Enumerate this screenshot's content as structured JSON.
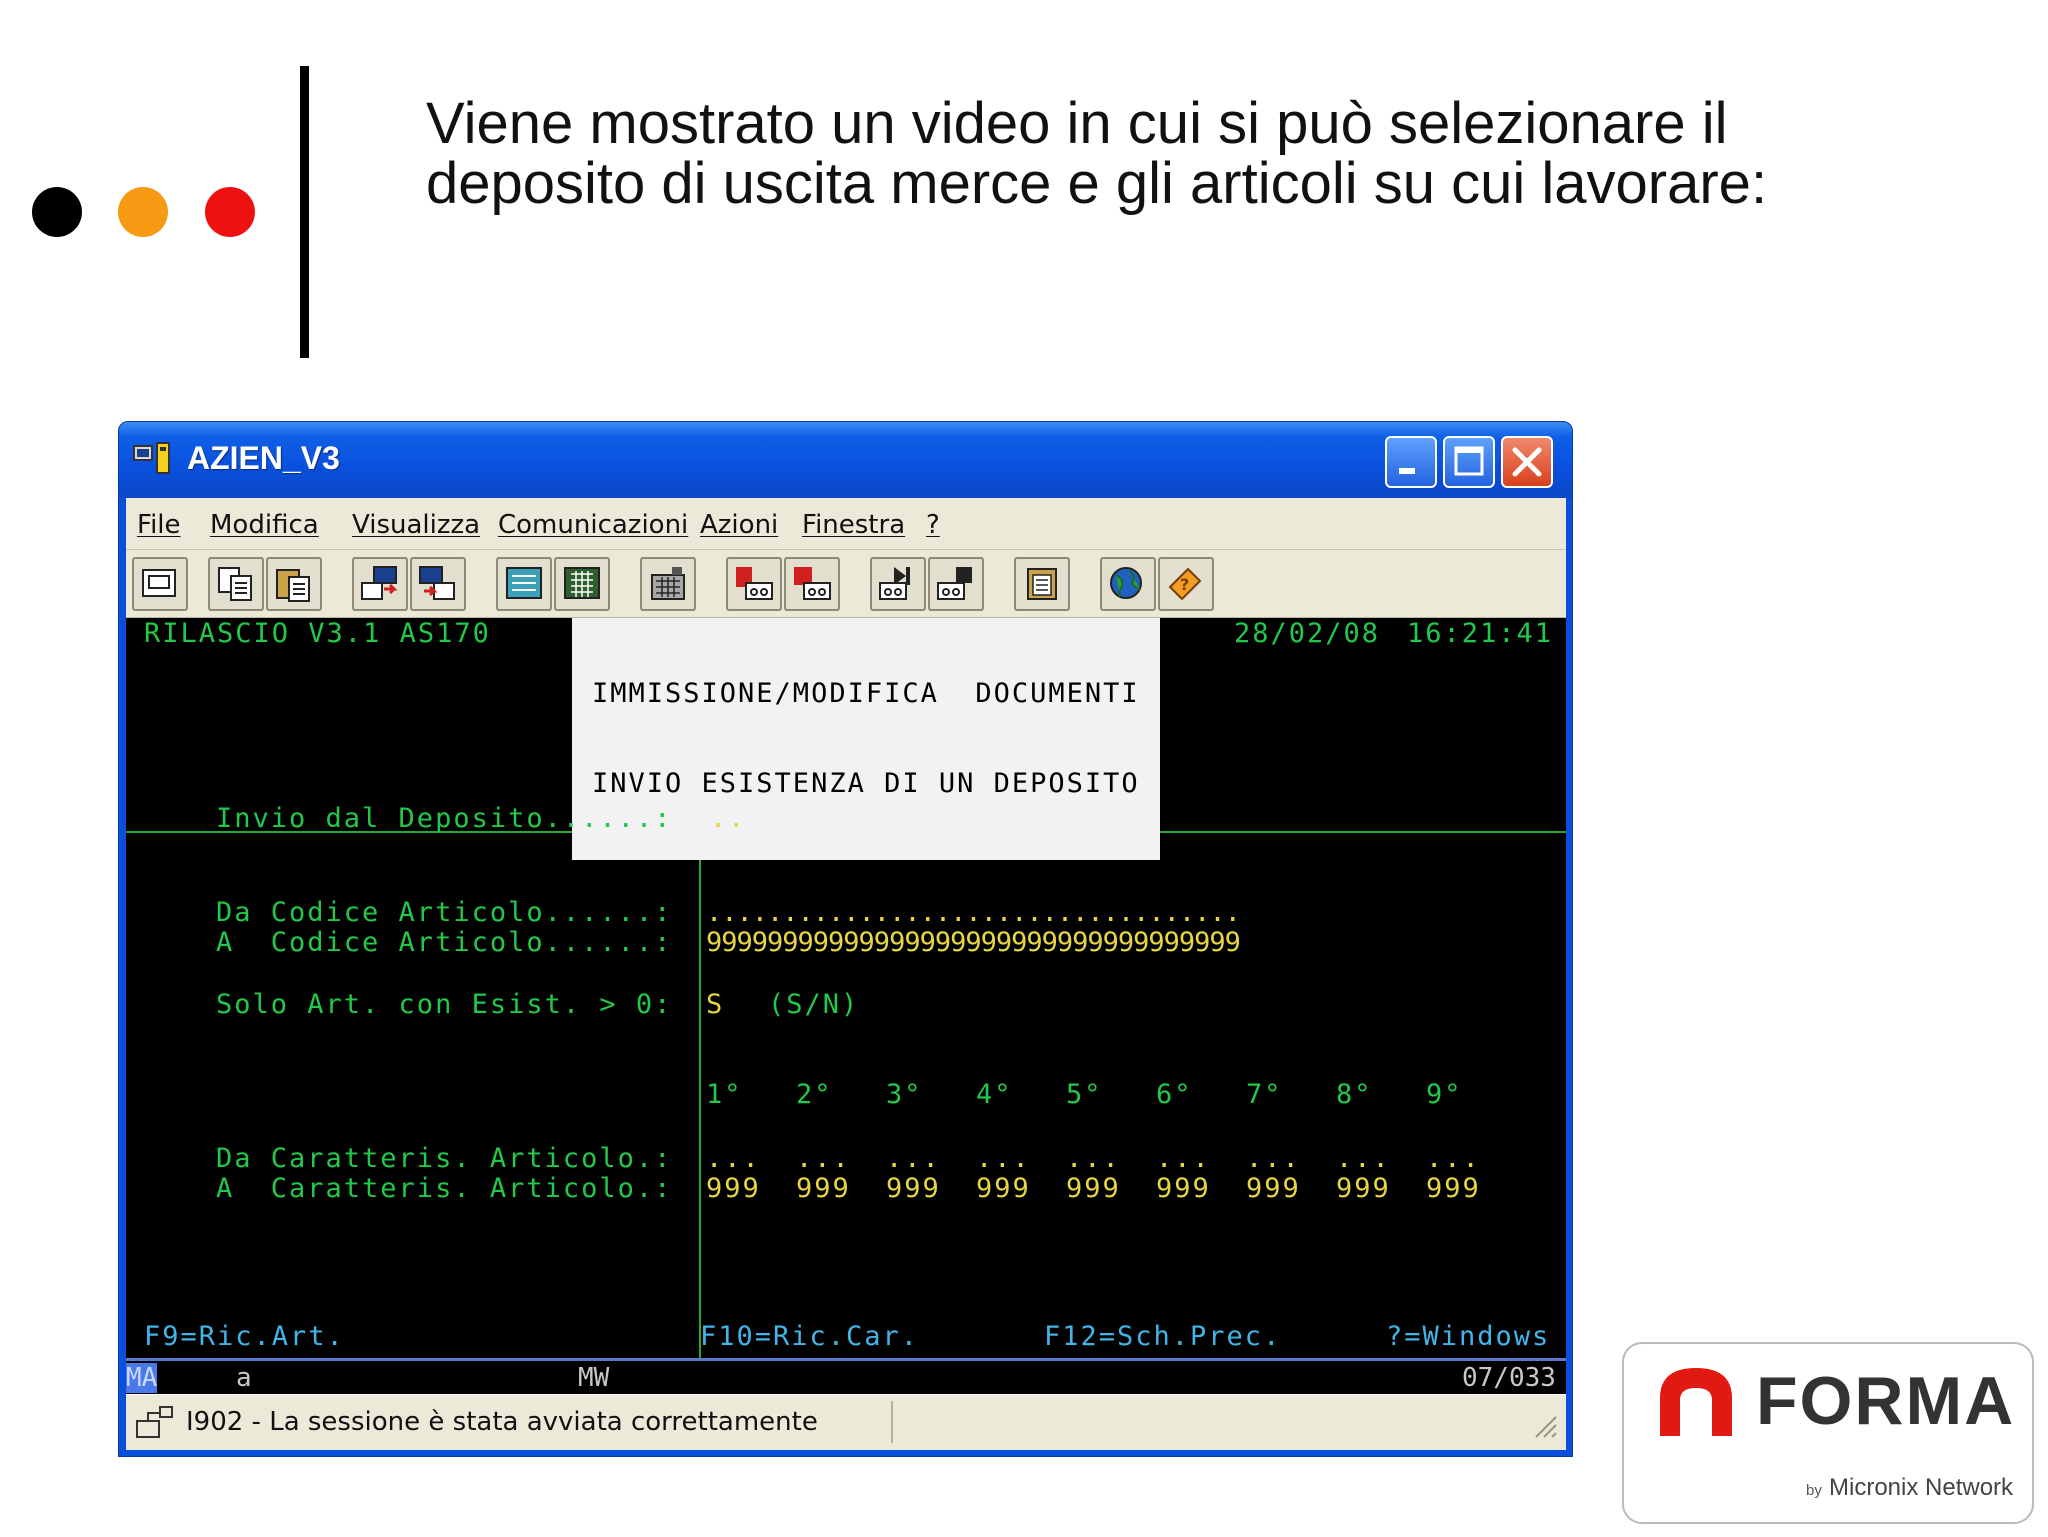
{
  "slide": {
    "title_line1": "Viene mostrato un video in cui si può selezionare il",
    "title_line2": "deposito di uscita merce e gli articoli su cui lavorare:"
  },
  "window": {
    "title": "AZIEN_V3",
    "controls": [
      "minimize-icon",
      "maximize-icon",
      "close-icon"
    ]
  },
  "menu": [
    "File",
    "Modifica",
    "Visualizza",
    "Comunicazioni",
    "Azioni",
    "Finestra",
    "?"
  ],
  "toolbar_icons": [
    "print-screen-icon",
    "copy-icon",
    "paste-icon",
    "send-icon",
    "receive-icon",
    "display-icon",
    "keypad-icon",
    "calculator-icon",
    "record-macro-icon",
    "stop-macro-icon",
    "play-macro-icon",
    "macro-icon",
    "clipboard-icon",
    "globe-icon",
    "help-icon"
  ],
  "terminal": {
    "release": "RILASCIO V3.1 AS170",
    "header_line1": "IMMISSIONE/MODIFICA  DOCUMENTI",
    "header_line2": "INVIO ESISTENZA DI UN DEPOSITO",
    "date": "28/02/08",
    "time": "16:21:41",
    "deposit_label": "Invio dal Deposito......:",
    "deposit_value": "..",
    "from_item_label": "Da Codice Articolo......:",
    "to_item_label": "A  Codice Articolo......:",
    "from_item_value": "...................................",
    "to_item_value": "99999999999999999999999999999999999",
    "stock_label": "Solo Art. con Esist. > 0:",
    "stock_value": "S",
    "stock_hint": "(S/N)",
    "char_headers": [
      "1°",
      "2°",
      "3°",
      "4°",
      "5°",
      "6°",
      "7°",
      "8°",
      "9°"
    ],
    "from_char_label": "Da Caratteris. Articolo.:",
    "to_char_label": "A  Caratteris. Articolo.:",
    "from_char_values": [
      "...",
      "...",
      "...",
      "...",
      "...",
      "...",
      "...",
      "...",
      "..."
    ],
    "to_char_values": [
      "999",
      "999",
      "999",
      "999",
      "999",
      "999",
      "999",
      "999",
      "999"
    ],
    "fkeys": [
      "F9=Ric.Art.",
      "F10=Ric.Car.",
      "F12=Sch.Prec.",
      "?=Windows"
    ]
  },
  "status": {
    "mode": "MA",
    "field": "a",
    "mw": "MW",
    "position": "07/033"
  },
  "message": "I902 - La sessione è stata avviata correttamente",
  "logo": {
    "word": "FORMA",
    "by": "by",
    "network": "Micronix Network"
  },
  "colors": {
    "terminal_bg": "#000000",
    "terminal_text": "#22c84a",
    "input_text": "#e6d640",
    "title_bar": "#0a50dc",
    "window_chrome": "#ece9d8",
    "logo_red": "#e01a12"
  }
}
